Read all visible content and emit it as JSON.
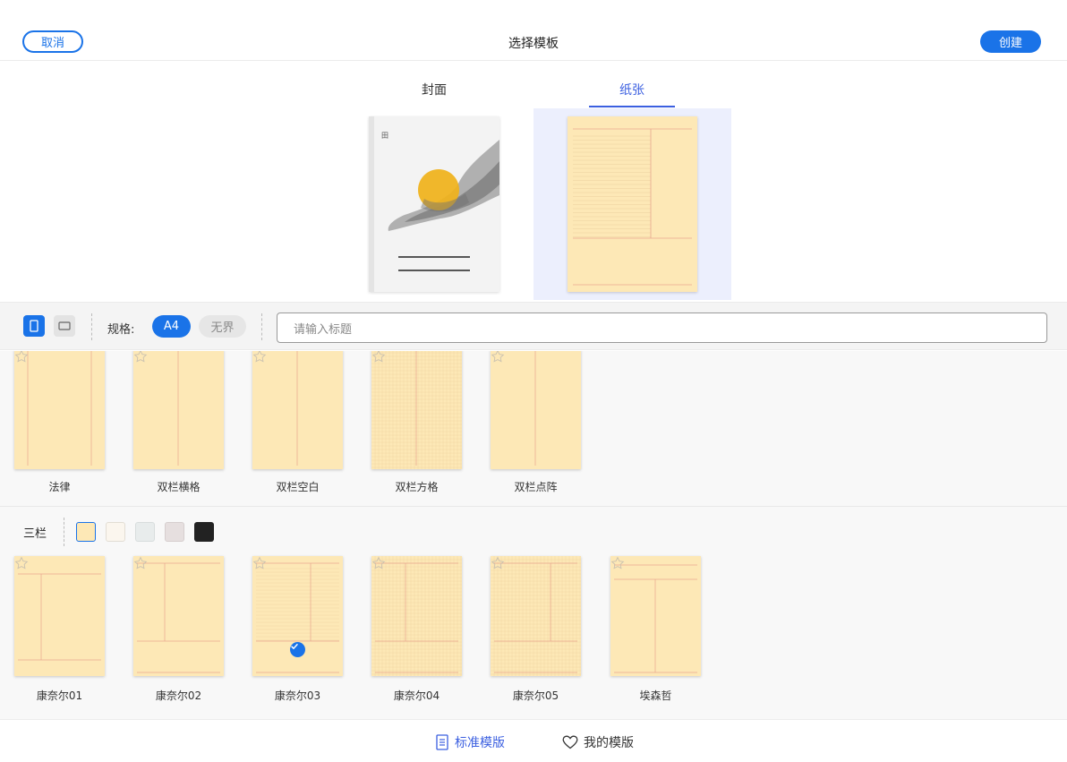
{
  "header": {
    "cancel_label": "取消",
    "title": "选择模板",
    "create_label": "创建"
  },
  "tabs": [
    {
      "label": "封面",
      "active": false
    },
    {
      "label": "纸张",
      "active": true
    }
  ],
  "toolbar": {
    "spec_label": "规格:",
    "spec_options": [
      "A4",
      "无界"
    ],
    "spec_selected": "A4",
    "search_placeholder": "请输入标题"
  },
  "templates_row1": [
    {
      "name": "法律"
    },
    {
      "name": "双栏横格"
    },
    {
      "name": "双栏空白"
    },
    {
      "name": "双栏方格"
    },
    {
      "name": "双栏点阵"
    }
  ],
  "section_three": {
    "label": "三栏",
    "swatches": [
      "#fde8b6",
      "#fbf6ee",
      "#e8ecec",
      "#e6dfdf",
      "#222222"
    ],
    "selected_swatch": 0
  },
  "templates_row2": [
    {
      "name": "康奈尔01"
    },
    {
      "name": "康奈尔02"
    },
    {
      "name": "康奈尔03",
      "selected": true
    },
    {
      "name": "康奈尔04"
    },
    {
      "name": "康奈尔05"
    },
    {
      "name": "埃森哲"
    }
  ],
  "bottom_tabs": [
    {
      "label": "标准模版",
      "active": true,
      "icon": "document-icon"
    },
    {
      "label": "我的模版",
      "active": false,
      "icon": "heart-icon"
    }
  ],
  "colors": {
    "accent": "#1a73e8",
    "tab_active": "#3b5fe0",
    "paper": "#fde8b6"
  }
}
